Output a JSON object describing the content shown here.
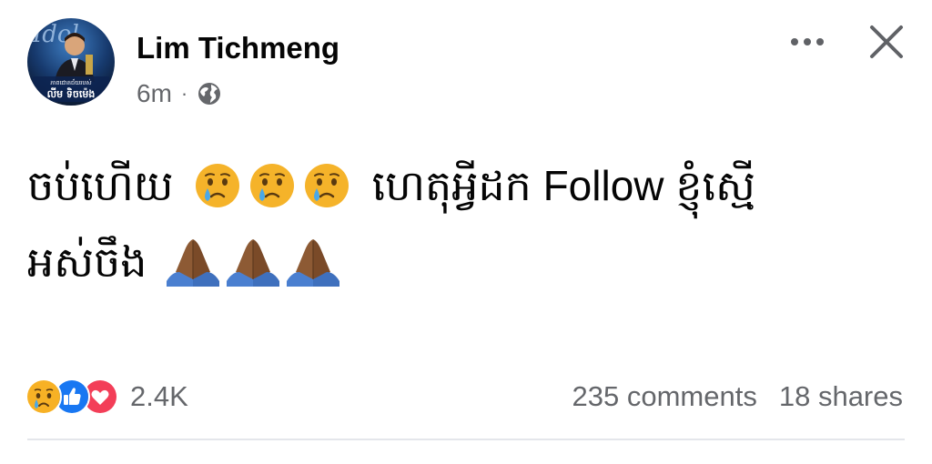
{
  "post": {
    "author": "Lim Tichmeng",
    "time": "6m",
    "separator": "·",
    "privacy_icon": "globe-icon",
    "avatar": {
      "overlay_line_1": "ភាពជោគជ័យរបស់",
      "overlay_line_2": "លីម ទិចម៉េង"
    },
    "text_line_1_before": "ចប់ហើយ",
    "text_line_1_emoji": [
      "crying-face",
      "crying-face",
      "crying-face"
    ],
    "text_line_1_after": "ហេតុអ្វីដក Follow ខ្ញុំស្មើ",
    "text_line_2_before": "អស់ចឹង",
    "text_line_2_emoji": [
      "folded-hands",
      "folded-hands",
      "folded-hands"
    ]
  },
  "footer": {
    "reaction_icons": [
      "sad-reaction",
      "like-reaction",
      "love-reaction"
    ],
    "reaction_count": "2.4K",
    "comments": "235 comments",
    "shares": "18 shares"
  },
  "colors": {
    "secondary_text": "#65676b",
    "like_blue": "#1877f2",
    "love_red": "#f33e58",
    "sad_yellow": "#f7b125"
  }
}
